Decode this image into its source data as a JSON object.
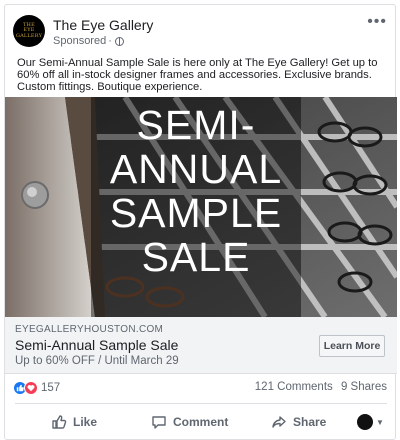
{
  "post": {
    "page_name": "The Eye Gallery",
    "sponsored_label": "Sponsored",
    "menu_glyph": "•••",
    "avatar_text": [
      "THE",
      "EYE",
      "GALLERY"
    ],
    "body": "Our Semi-Annual Sample Sale is here only at The Eye Gallery! Get up to 60% off all in-stock designer frames and accessories. Exclusive brands. Custom fittings. Boutique experience."
  },
  "hero": {
    "title_lines": [
      "SEMI-",
      "ANNUAL",
      "SAMPLE",
      "SALE"
    ]
  },
  "cta": {
    "domain": "EYEGALLERYHOUSTON.COM",
    "headline": "Semi-Annual Sample Sale",
    "subline": "Up to 60% OFF / Until March 29",
    "button_label": "Learn More"
  },
  "engagement": {
    "reaction_count": "157",
    "comments": "121 Comments",
    "shares": "9 Shares"
  },
  "actions": {
    "like": "Like",
    "comment": "Comment",
    "share": "Share"
  },
  "icons": [
    "globe-icon",
    "more-options-icon",
    "like-reaction-icon",
    "love-reaction-icon",
    "thumbs-up-icon",
    "comment-icon",
    "share-icon",
    "profile-avatar-icon",
    "caret-down-icon"
  ],
  "colors": {
    "accent": "#1877f2",
    "love": "#f33e58",
    "muted": "#606770"
  }
}
